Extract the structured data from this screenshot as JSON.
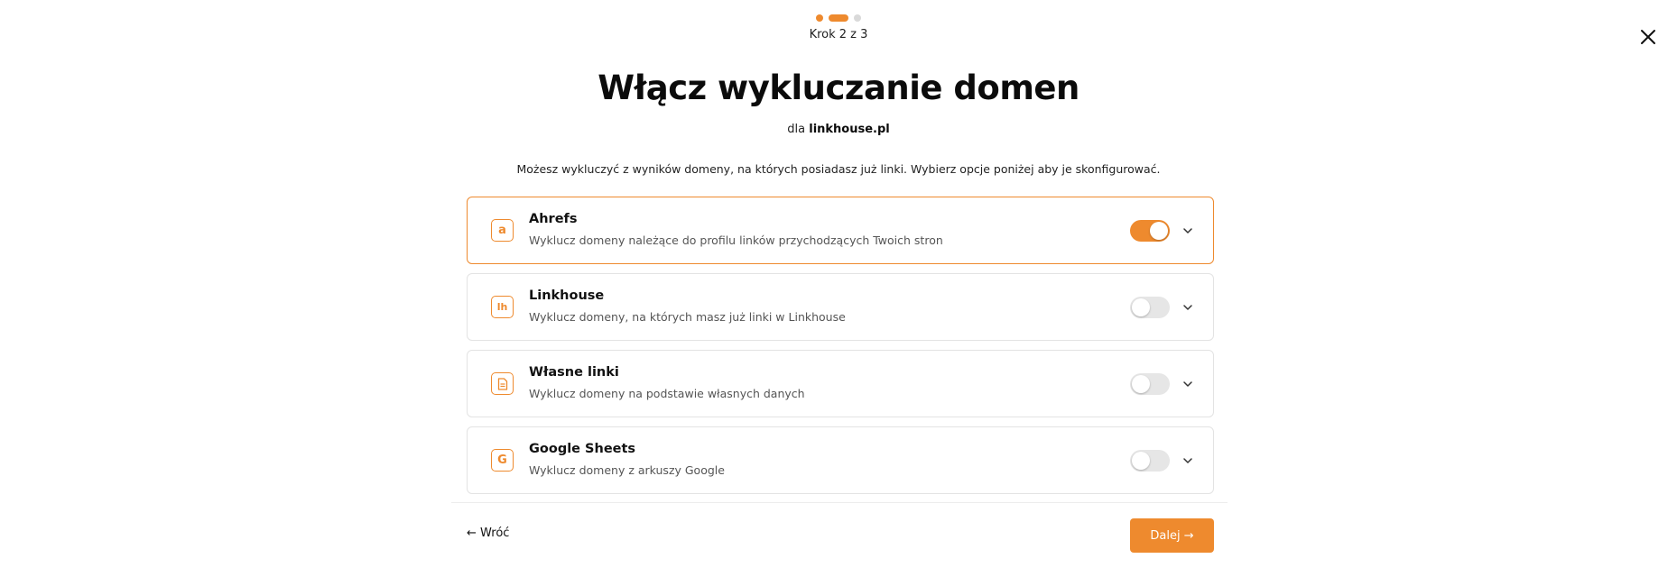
{
  "stepper": {
    "steps_total": 3,
    "current_step": 2,
    "label": "Krok 2 z 3"
  },
  "header": {
    "title": "Włącz wykluczanie domen",
    "subtitle_prefix": "dla",
    "domain": "linkhouse.pl",
    "description": "Możesz wykluczyć z wyników domeny, na których posiadasz już linki. Wybierz opcje poniżej aby je skonfigurować."
  },
  "options": [
    {
      "title": "Ahrefs",
      "description": "Wyklucz domeny należące do profilu linków przychodzących Twoich stron",
      "icon": "ahrefs-icon",
      "icon_text": "a",
      "enabled": true
    },
    {
      "title": "Linkhouse",
      "description": "Wyklucz domeny, na których masz już linki w Linkhouse",
      "icon": "linkhouse-icon",
      "icon_text": "lh",
      "enabled": false
    },
    {
      "title": "Własne linki",
      "description": "Wyklucz domeny na podstawie własnych danych",
      "icon": "document-icon",
      "icon_text": "",
      "enabled": false
    },
    {
      "title": "Google Sheets",
      "description": "Wyklucz domeny z arkuszy Google",
      "icon": "google-icon",
      "icon_text": "G",
      "enabled": false
    }
  ],
  "footer": {
    "back_label": "← Wróć",
    "next_label": "Dalej →"
  },
  "colors": {
    "accent": "#ee8a2e",
    "toggle_off": "#e6e6e6",
    "border": "#e3e3e3"
  }
}
